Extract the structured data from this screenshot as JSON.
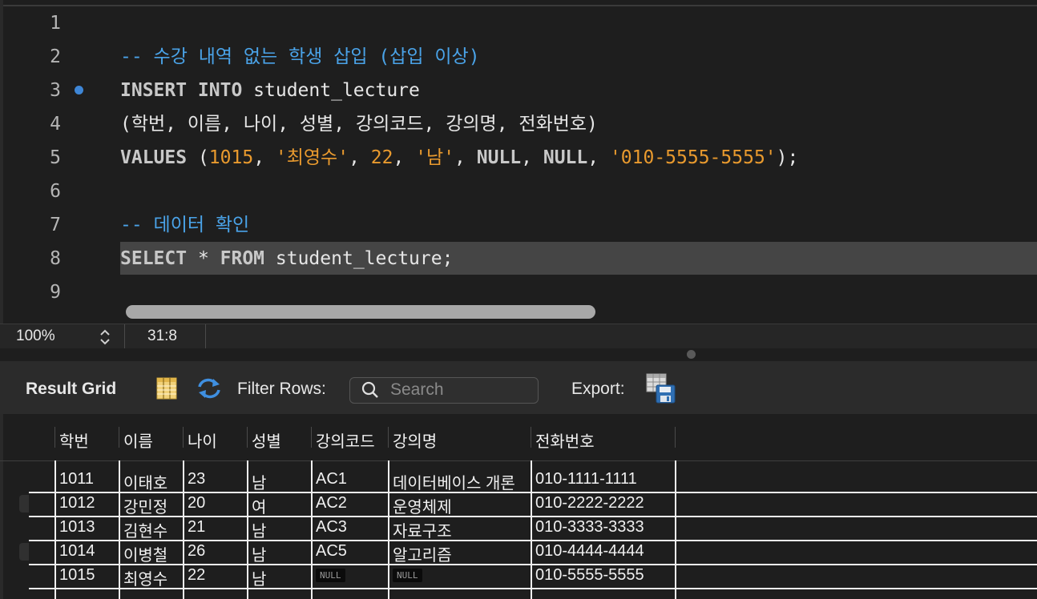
{
  "editor": {
    "lines": [
      {
        "num": "1",
        "tokens": []
      },
      {
        "num": "2",
        "tokens": [
          {
            "t": "-- 수강 내역 없는 학생 삽입 (삽입 이상)",
            "c": "cm"
          }
        ]
      },
      {
        "num": "3",
        "tokens": [
          {
            "t": "INSERT INTO ",
            "c": "kw"
          },
          {
            "t": "student_lecture",
            "c": ""
          }
        ]
      },
      {
        "num": "4",
        "tokens": [
          {
            "t": "(학번, 이름, 나이, 성별, 강의코드, 강의명, 전화번호)",
            "c": ""
          }
        ]
      },
      {
        "num": "5",
        "tokens": [
          {
            "t": "VALUES ",
            "c": "kw"
          },
          {
            "t": "(",
            "c": ""
          },
          {
            "t": "1015",
            "c": "num"
          },
          {
            "t": ", ",
            "c": ""
          },
          {
            "t": "'최영수'",
            "c": "str"
          },
          {
            "t": ", ",
            "c": ""
          },
          {
            "t": "22",
            "c": "num"
          },
          {
            "t": ", ",
            "c": ""
          },
          {
            "t": "'남'",
            "c": "str"
          },
          {
            "t": ", ",
            "c": ""
          },
          {
            "t": "NULL",
            "c": "kw"
          },
          {
            "t": ", ",
            "c": ""
          },
          {
            "t": "NULL",
            "c": "kw"
          },
          {
            "t": ", ",
            "c": ""
          },
          {
            "t": "'010-5555-5555'",
            "c": "str"
          },
          {
            "t": ");",
            "c": ""
          }
        ]
      },
      {
        "num": "6",
        "tokens": []
      },
      {
        "num": "7",
        "tokens": [
          {
            "t": "-- 데이터 확인",
            "c": "cm"
          }
        ]
      },
      {
        "num": "8",
        "tokens": [
          {
            "t": "SELECT ",
            "c": "kw"
          },
          {
            "t": "* ",
            "c": ""
          },
          {
            "t": "FROM ",
            "c": "kw"
          },
          {
            "t": "student_lecture;",
            "c": ""
          }
        ]
      },
      {
        "num": "9",
        "tokens": []
      }
    ],
    "breakpoint_line": "3",
    "highlight_line": "8"
  },
  "statusbar": {
    "zoom": "100%",
    "cursor_position": "31:8"
  },
  "toolbar": {
    "result_grid_label": "Result Grid",
    "filter_label": "Filter Rows:",
    "search_placeholder": "Search",
    "export_label": "Export:"
  },
  "grid": {
    "columns": [
      "학번",
      "이름",
      "나이",
      "성별",
      "강의코드",
      "강의명",
      "전화번호"
    ],
    "rows": [
      [
        "1011",
        "이태호",
        "23",
        "남",
        "AC1",
        "데이터베이스 개론",
        "010-1111-1111"
      ],
      [
        "1012",
        "강민정",
        "20",
        "여",
        "AC2",
        "운영체제",
        "010-2222-2222"
      ],
      [
        "1013",
        "김현수",
        "21",
        "남",
        "AC3",
        "자료구조",
        "010-3333-3333"
      ],
      [
        "1014",
        "이병철",
        "26",
        "남",
        "AC5",
        "알고리즘",
        "010-4444-4444"
      ],
      [
        "1015",
        "최영수",
        "22",
        "남",
        "NULL",
        "NULL",
        "010-5555-5555"
      ]
    ],
    "null_label": "NULL"
  },
  "colors": {
    "comment": "#4aa3e8",
    "string": "#e99a2e",
    "keyword": "#c8c8c8",
    "breakpoint": "#3e86d6"
  },
  "icons": {
    "grid_view": "grid-view-icon",
    "refresh": "refresh-icon",
    "search": "search-icon",
    "export": "export-icon",
    "stepper": "zoom-stepper-icon"
  }
}
